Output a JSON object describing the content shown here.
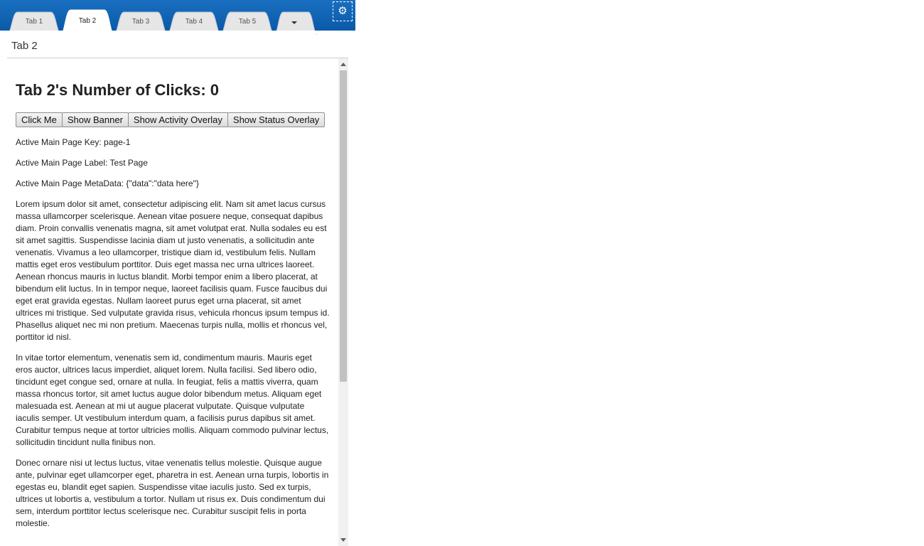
{
  "tabs": [
    {
      "label": "Tab 1",
      "active": false
    },
    {
      "label": "Tab 2",
      "active": true
    },
    {
      "label": "Tab 3",
      "active": false
    },
    {
      "label": "Tab 4",
      "active": false
    },
    {
      "label": "Tab 5",
      "active": false
    }
  ],
  "settings_icon": "gear-icon",
  "overflow_icon": "chevron-down-icon",
  "page": {
    "title": "Tab 2"
  },
  "content": {
    "heading": "Tab 2's Number of Clicks: 0",
    "buttons": {
      "click_me": "Click Me",
      "show_banner": "Show Banner",
      "show_activity_overlay": "Show Activity Overlay",
      "show_status_overlay": "Show Status Overlay"
    },
    "active_key": "Active Main Page Key: page-1",
    "active_label": "Active Main Page Label: Test Page",
    "active_metadata": "Active Main Page MetaData: {\"data\":\"data here\"}",
    "paragraphs": [
      "Lorem ipsum dolor sit amet, consectetur adipiscing elit. Nam sit amet lacus cursus massa ullamcorper scelerisque. Aenean vitae posuere neque, consequat dapibus diam. Proin convallis venenatis magna, sit amet volutpat erat. Nulla sodales eu est sit amet sagittis. Suspendisse lacinia diam ut justo venenatis, a sollicitudin ante venenatis. Vivamus a leo ullamcorper, tristique diam id, vestibulum felis. Nullam mattis eget eros vestibulum porttitor. Duis eget massa nec urna ultrices laoreet. Aenean rhoncus mauris in luctus blandit. Morbi tempor enim a libero placerat, at bibendum elit luctus. In in tempor neque, laoreet facilisis quam. Fusce faucibus dui eget erat gravida egestas. Nullam laoreet purus eget urna placerat, sit amet ultrices mi tristique. Sed vulputate gravida risus, vehicula rhoncus ipsum tempus id. Phasellus aliquet nec mi non pretium. Maecenas turpis nulla, mollis et rhoncus vel, porttitor id nisl.",
      "In vitae tortor elementum, venenatis sem id, condimentum mauris. Mauris eget eros auctor, ultrices lacus imperdiet, aliquet lorem. Nulla facilisi. Sed libero odio, tincidunt eget congue sed, ornare at nulla. In feugiat, felis a mattis viverra, quam massa rhoncus tortor, sit amet luctus augue dolor bibendum metus. Aliquam eget malesuada est. Aenean at mi ut augue placerat vulputate. Quisque vulputate iaculis semper. Ut vestibulum interdum quam, a facilisis purus dapibus sit amet. Curabitur tempus neque at tortor ultricies mollis. Aliquam commodo pulvinar lectus, sollicitudin tincidunt nulla finibus non.",
      "Donec ornare nisi ut lectus luctus, vitae venenatis tellus molestie. Quisque augue ante, pulvinar eget ullamcorper eget, pharetra in est. Aenean urna turpis, lobortis in egestas eu, blandit eget sapien. Suspendisse vitae iaculis justo. Sed ex turpis, ultrices ut lobortis a, vestibulum a tortor. Nullam ut risus ex. Duis condimentum dui sem, interdum porttitor lectus scelerisque nec. Curabitur suscipit felis in porta molestie."
    ]
  },
  "colors": {
    "tabstrip": "#0a5aa8",
    "tab_inactive": "#e6e6e6",
    "tab_active": "#ffffff"
  }
}
